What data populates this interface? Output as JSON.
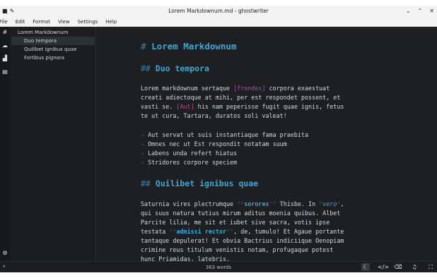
{
  "window": {
    "title": "Lorem Markdownum.md - ghostwriter"
  },
  "menu": [
    "File",
    "Edit",
    "Format",
    "View",
    "Settings",
    "Help"
  ],
  "outline": [
    {
      "label": "Lorem Markdownum",
      "level": 1
    },
    {
      "label": "Duo tempora",
      "level": 2,
      "active": true
    },
    {
      "label": "Quilibet ignibus quae",
      "level": 2
    },
    {
      "label": "Fortibus pignora",
      "level": 2
    }
  ],
  "doc": {
    "h1_mark": "#",
    "h1_text": "Lorem Markdownum",
    "h2a_mark": "##",
    "h2a_text": "Duo tempora",
    "p1_l1_a": "Lorem markdownum sertaque ",
    "p1_l1_link": "[frondes]",
    "p1_l1_b": " corpora exaestuat",
    "p1_l2": "creati adiectoque at mihi, per est respondet possent, et",
    "p1_l3_a": "vasti se. ",
    "p1_l3_link": "[Aut]",
    "p1_l3_b": " his nam peperisse fugit quae ignis, fetus",
    "p1_l4": "te ut cura, Tartara, duratos soli valeat!",
    "bullet": "-",
    "li1": " Aut servat ut suis instantiaque fama praebita",
    "li2": " Omnes nec ut Est respondit notatam suum",
    "li3": " Labens unda refert hiatus",
    "li4": " Stridores corpore speciem",
    "h2b_mark": "##",
    "h2b_text": "Quilibet ignibus quae",
    "p2_l1_a": "Saturnia vires plectrumque ",
    "p2_l1_m1": "**",
    "p2_l1_strong": "sorores",
    "p2_l1_m2": "**",
    "p2_l1_b": " Thisbe. In ",
    "p2_l1_m3": "*",
    "p2_l1_em": "vero",
    "p2_l1_m4": "*",
    "p2_l1_c": ",",
    "p2_l2": "qui suus natura tutius mirum aditus moenia quibus. Albet",
    "p2_l3": "Parcite lilia, me sit et iubet sive sacra, votis ipse",
    "p2_l4_a": "testata ",
    "p2_l4_m1": "**",
    "p2_l4_strong": "admissi rector",
    "p2_l4_m2": "**",
    "p2_l4_b": ", de, tumulo! Et Agaue portante",
    "p2_l5": "tantaque depulerat! Et obvia Bactrius indiciique Oenopiam",
    "p2_l6": "crimine reus titulum venistis notam, profugaque potest",
    "p2_l7": "hunc Priamidas, latebris."
  },
  "status": {
    "word_count": "363 words"
  },
  "icons": {
    "titlebar_left": [
      "app-icon",
      "pin-icon"
    ],
    "titlebar_right": [
      "chevron-down-icon",
      "chevron-up-icon",
      "close-icon"
    ],
    "strip": [
      "outline-icon",
      "cloud-icon",
      "statistics-icon",
      "html-preview-icon",
      "settings-icon"
    ],
    "status_right": [
      "dark-mode-icon",
      "code-icon",
      "clear-icon",
      "audio-icon",
      "fullscreen-icon"
    ]
  },
  "colors": {
    "background": "#1d1f21",
    "heading": "#3aa8d8",
    "link": "#c8449c",
    "text": "#d8d8d8"
  }
}
